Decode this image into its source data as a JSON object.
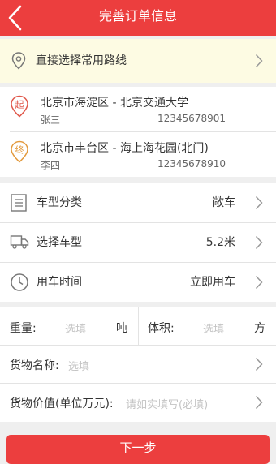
{
  "header": {
    "title": "完善订单信息"
  },
  "route": {
    "label": "直接选择常用路线"
  },
  "start": {
    "badge": "起",
    "address": "北京市海淀区 - 北京交通大学",
    "name": "张三",
    "phone": "12345678901"
  },
  "end": {
    "badge": "终",
    "address": "北京市丰台区 - 海上海花园(北门)",
    "name": "李四",
    "phone": "12345678910"
  },
  "vehicle": {
    "type_label": "车型分类",
    "type_value": "敞车",
    "model_label": "选择车型",
    "model_value": "5.2米",
    "time_label": "用车时间",
    "time_value": "立即用车"
  },
  "cargo": {
    "weight_label": "重量:",
    "weight_placeholder": "选填",
    "weight_unit": "吨",
    "volume_label": "体积:",
    "volume_placeholder": "选填",
    "volume_unit": "方",
    "name_label": "货物名称:",
    "name_placeholder": "选填",
    "value_label": "货物价值(单位万元):",
    "value_placeholder": "请如实填写(必填)"
  },
  "next_button": "下一步",
  "colors": {
    "primary": "#ec3e3e",
    "route_bg": "#fdfbe3",
    "start_icon": "#e0574a",
    "end_icon": "#e39a3d"
  }
}
